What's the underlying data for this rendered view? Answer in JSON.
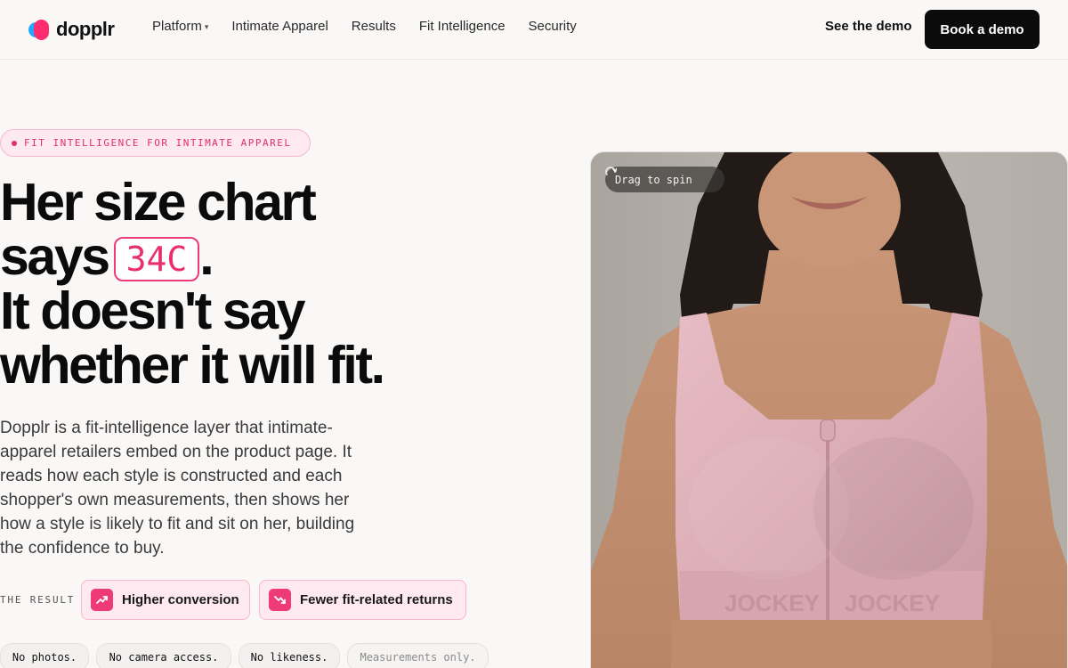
{
  "brand": {
    "name": "dopplr",
    "colors": {
      "blue": "#23a7ff",
      "pink": "#ff2d6f",
      "accent": "#ee3b78"
    }
  },
  "nav": {
    "items": [
      {
        "label": "Platform",
        "has_dropdown": true
      },
      {
        "label": "Intimate Apparel"
      },
      {
        "label": "Results"
      },
      {
        "label": "Fit Intelligence"
      },
      {
        "label": "Security"
      }
    ],
    "dropdown_icon": "chevron-down-icon",
    "see_demo": "See the demo",
    "book_demo": "Book a demo"
  },
  "hero": {
    "eyebrow": "FIT INTELLIGENCE FOR INTIMATE APPAREL",
    "headline": {
      "line1": "Her size chart",
      "line2_prefix": "says",
      "size": "34C",
      "line2_suffix": ".",
      "line3": "It doesn't say",
      "line4": "whether it will fit."
    },
    "body": "Dopplr is a fit-intelligence layer that intimate-apparel retailers embed on the product page. It reads how each style is constructed and each shopper's own measurements, then shows her how a style is likely to fit and sit on her, building the confidence to buy.",
    "result_label": "THE RESULT",
    "results": [
      {
        "label": "Higher conversion",
        "icon": "trending-up-icon"
      },
      {
        "label": "Fewer fit-related returns",
        "icon": "trending-down-icon"
      }
    ],
    "privacy": [
      "No photos.",
      "No camera access.",
      "No likeness.",
      "Measurements only."
    ],
    "media": {
      "spin_label": "Drag to spin",
      "spin_icon": "rotate-icon",
      "garment_brand": "JOCKEY"
    }
  }
}
